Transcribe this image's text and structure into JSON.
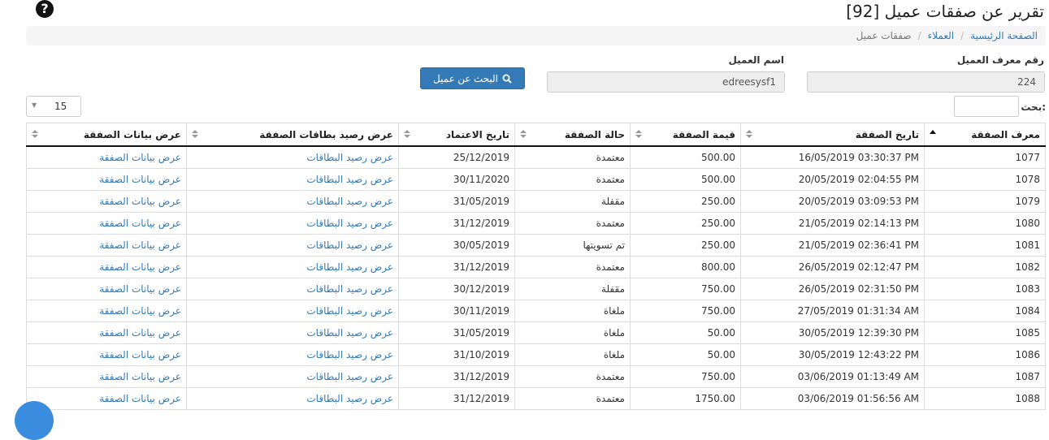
{
  "page": {
    "title": "تقرير عن صفقات عميل [92]",
    "help_icon": "question-circle-icon"
  },
  "breadcrumb": {
    "home": "الصفحة الرئيسية",
    "customers": "العملاء",
    "current": "صفقات عميل"
  },
  "form": {
    "customer_id_label": "رقم معرف العميل",
    "customer_id_value": "224",
    "customer_name_label": "اسم العميل",
    "customer_name_value": "edreesysf1",
    "search_button_label": "البحث عن عميل",
    "search_button_icon": "search-icon"
  },
  "table_controls": {
    "page_length": "15",
    "search_label": ":بحث",
    "search_value": ""
  },
  "table": {
    "columns": [
      {
        "key": "id",
        "label": "معرف الصفقة",
        "sort": "asc"
      },
      {
        "key": "date",
        "label": "تاريخ الصفقة",
        "sort": "both"
      },
      {
        "key": "value",
        "label": "قيمة الصفقة",
        "sort": "both"
      },
      {
        "key": "status",
        "label": "حالة الصفقة",
        "sort": "both"
      },
      {
        "key": "approval",
        "label": "تاريخ الاعتماد",
        "sort": "both"
      },
      {
        "key": "balance",
        "label": "عرض رصيد بطاقات الصفقة",
        "sort": "both"
      },
      {
        "key": "details",
        "label": "عرض بيانات الصفقة",
        "sort": "both"
      }
    ],
    "rows": [
      {
        "id": "1077",
        "date": "16/05/2019 03:30:37 PM",
        "value": "500.00",
        "status": "معتمدة",
        "approval": "25/12/2019",
        "balance": "عرض رصيد البطاقات",
        "details": "عرض بيانات الصفقة"
      },
      {
        "id": "1078",
        "date": "20/05/2019 02:04:55 PM",
        "value": "500.00",
        "status": "معتمدة",
        "approval": "30/11/2020",
        "balance": "عرض رصيد البطاقات",
        "details": "عرض بيانات الصفقة"
      },
      {
        "id": "1079",
        "date": "20/05/2019 03:09:53 PM",
        "value": "250.00",
        "status": "مقفلة",
        "approval": "31/05/2019",
        "balance": "عرض رصيد البطاقات",
        "details": "عرض بيانات الصفقة"
      },
      {
        "id": "1080",
        "date": "21/05/2019 02:14:13 PM",
        "value": "250.00",
        "status": "معتمدة",
        "approval": "31/12/2019",
        "balance": "عرض رصيد البطاقات",
        "details": "عرض بيانات الصفقة"
      },
      {
        "id": "1081",
        "date": "21/05/2019 02:36:41 PM",
        "value": "250.00",
        "status": "تم تسويتها",
        "approval": "30/05/2019",
        "balance": "عرض رصيد البطاقات",
        "details": "عرض بيانات الصفقة"
      },
      {
        "id": "1082",
        "date": "26/05/2019 02:12:47 PM",
        "value": "800.00",
        "status": "معتمدة",
        "approval": "31/12/2019",
        "balance": "عرض رصيد البطاقات",
        "details": "عرض بيانات الصفقة"
      },
      {
        "id": "1083",
        "date": "26/05/2019 02:31:50 PM",
        "value": "750.00",
        "status": "مقفلة",
        "approval": "30/12/2019",
        "balance": "عرض رصيد البطاقات",
        "details": "عرض بيانات الصفقة"
      },
      {
        "id": "1084",
        "date": "27/05/2019 01:31:34 AM",
        "value": "750.00",
        "status": "ملغاة",
        "approval": "30/11/2019",
        "balance": "عرض رصيد البطاقات",
        "details": "عرض بيانات الصفقة"
      },
      {
        "id": "1085",
        "date": "30/05/2019 12:39:30 PM",
        "value": "50.00",
        "status": "ملغاة",
        "approval": "31/05/2019",
        "balance": "عرض رصيد البطاقات",
        "details": "عرض بيانات الصفقة"
      },
      {
        "id": "1086",
        "date": "30/05/2019 12:43:22 PM",
        "value": "50.00",
        "status": "ملغاة",
        "approval": "31/10/2019",
        "balance": "عرض رصيد البطاقات",
        "details": "عرض بيانات الصفقة"
      },
      {
        "id": "1087",
        "date": "03/06/2019 01:13:49 AM",
        "value": "750.00",
        "status": "معتمدة",
        "approval": "31/12/2019",
        "balance": "عرض رصيد البطاقات",
        "details": "عرض بيانات الصفقة"
      },
      {
        "id": "1088",
        "date": "03/06/2019 01:56:56 AM",
        "value": "1750.00",
        "status": "معتمدة",
        "approval": "31/12/2019",
        "balance": "عرض رصيد البطاقات",
        "details": "عرض بيانات الصفقة"
      }
    ]
  },
  "colors": {
    "primary": "#337ab7",
    "breadcrumb_bg": "#f5f5f5",
    "readonly_bg": "#eeeeee"
  }
}
